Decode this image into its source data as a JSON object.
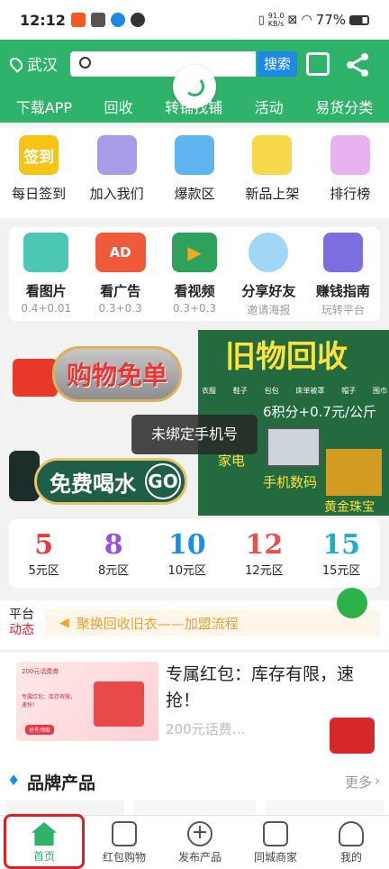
{
  "status": {
    "time": "12:12",
    "net": "91.0\nKB/s",
    "battery": "77%"
  },
  "header": {
    "city": "武汉",
    "search_btn": "搜索",
    "nav": [
      "下载APP",
      "回收",
      "转铺找铺",
      "活动",
      "易货分类"
    ]
  },
  "row1": [
    {
      "label": "每日签到",
      "icon": "签到"
    },
    {
      "label": "加入我们"
    },
    {
      "label": "爆款区"
    },
    {
      "label": "新品上架"
    },
    {
      "label": "排行榜"
    }
  ],
  "row2": [
    {
      "label": "看图片",
      "sub": "0.4+0.01"
    },
    {
      "label": "看广告",
      "sub": "0.3+0.3",
      "icon": "AD"
    },
    {
      "label": "看视频",
      "sub": "0.3+0.3"
    },
    {
      "label": "分享好友",
      "sub": "邀请海报"
    },
    {
      "label": "赚钱指南",
      "sub": "玩转平台"
    }
  ],
  "banners": {
    "shop_free": "购物免单",
    "free_water": "免费喝水",
    "go": "GO",
    "recycle_title": "旧物回收",
    "recycle_items": [
      "衣服",
      "鞋子",
      "包包",
      "床单被罩",
      "帽子",
      "围巾"
    ],
    "recycle_rate": "6积分+0.7元/公斤",
    "appliance": "家电",
    "digital": "手机数码",
    "gold": "黄金珠宝",
    "toast": "未绑定手机号"
  },
  "prices": [
    {
      "val": "5",
      "label": "5元区",
      "color": "#e63b3b"
    },
    {
      "val": "8",
      "label": "8元区",
      "color": "#9b4fe0"
    },
    {
      "val": "10",
      "label": "10元区",
      "color": "#1a8ee6"
    },
    {
      "val": "12",
      "label": "12元区",
      "color": "#e85050"
    },
    {
      "val": "15",
      "label": "15元区",
      "color": "#1ab0c8"
    }
  ],
  "notice": {
    "tag1": "平台",
    "tag2": "动态",
    "text": "聚换回收旧衣——加盟流程"
  },
  "promo": {
    "title": "专属红包：库存有限，速抢！",
    "sub": "200元话费…",
    "img_text1": "200元话费券",
    "img_text2": "专属红包：库存有限，速抢！",
    "img_btn": "抢先领取"
  },
  "brand": {
    "title": "品牌产品",
    "more": "更多"
  },
  "tabs": [
    "首页",
    "红包购物",
    "发布产品",
    "同城商家",
    "我的"
  ]
}
